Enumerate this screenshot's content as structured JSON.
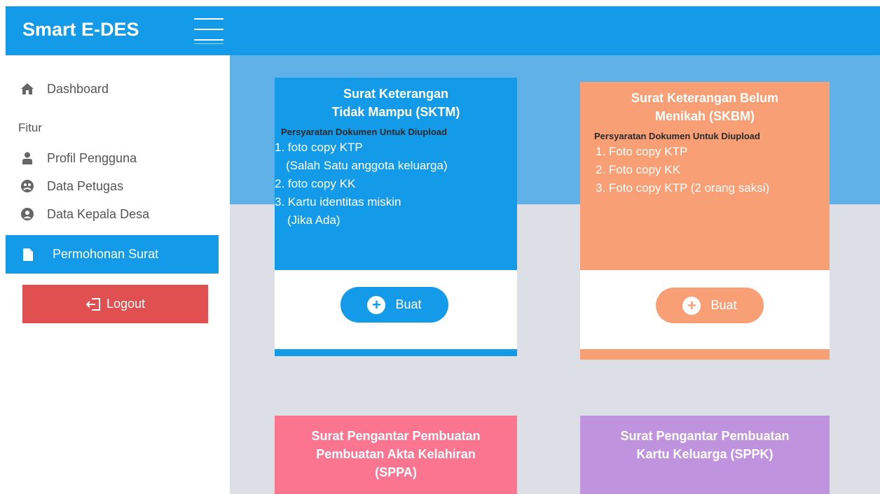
{
  "app": {
    "title": "Smart E-DES"
  },
  "sidebar": {
    "dashboard_label": "Dashboard",
    "section_label": "Fitur",
    "items": [
      {
        "label": "Profil Pengguna",
        "icon": "user-icon"
      },
      {
        "label": "Data Petugas",
        "icon": "officer-icon"
      },
      {
        "label": "Data Kepala Desa",
        "icon": "user-circle-icon"
      }
    ],
    "active_item": {
      "label": "Permohonan Surat",
      "icon": "document-icon"
    },
    "logout_label": "Logout"
  },
  "cards": [
    {
      "title_line1": "Surat Keterangan",
      "title_line2": "Tidak Mampu (SKTM)",
      "requirements_heading": "Persyaratan Dokumen Untuk Diupload",
      "requirements": [
        "1. foto copy KTP",
        "(Salah Satu anggota keluarga)",
        "2. foto copy KK",
        "3. Kartu identitas miskin",
        "(Jika Ada)"
      ],
      "button_label": "Buat",
      "color": "#139ae8"
    },
    {
      "title_line1": "Surat Keterangan Belum",
      "title_line2": "Menikah (SKBM)",
      "requirements_heading": "Persyaratan Dokumen Untuk Diupload",
      "requirements": [
        "1. Foto copy KTP",
        "2. Foto copy KK",
        "3. Foto copy KTP (2 orang saksi)"
      ],
      "button_label": "Buat",
      "color": "#f99f76"
    },
    {
      "title_line1": "Surat Pengantar Pembuatan",
      "title_line2": "Pembuatan Akta Kelahiran",
      "title_line3": "(SPPA)",
      "color": "#fb7490"
    },
    {
      "title_line1": "Surat Pengantar Pembuatan",
      "title_line2": "Kartu Keluarga (SPPK)",
      "color": "#c093de"
    }
  ]
}
